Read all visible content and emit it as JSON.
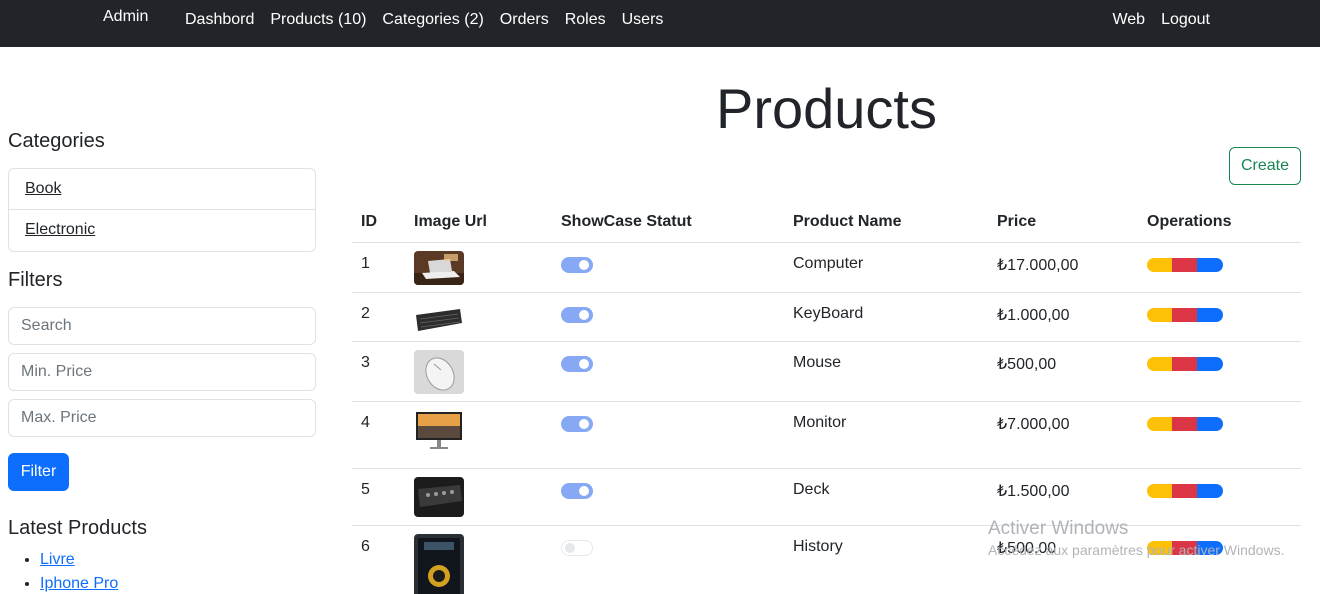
{
  "navbar": {
    "brand": "Admin",
    "links": [
      "Dashbord",
      "Products (10)",
      "Categories (2)",
      "Orders",
      "Roles",
      "Users"
    ],
    "right_links": [
      "Web",
      "Logout"
    ]
  },
  "sidebar": {
    "categories_title": "Categories",
    "categories": [
      "Book",
      "Electronic"
    ],
    "filters_title": "Filters",
    "search_placeholder": "Search",
    "min_price_placeholder": "Min. Price",
    "max_price_placeholder": "Max. Price",
    "filter_button": "Filter",
    "latest_title": "Latest Products",
    "latest": [
      "Livre",
      "Iphone Pro"
    ]
  },
  "main": {
    "title": "Products",
    "create_button": "Create",
    "columns": [
      "ID",
      "Image Url",
      "ShowCase Statut",
      "Product Name",
      "Price",
      "Operations"
    ],
    "rows": [
      {
        "id": "1",
        "name": "Computer",
        "price": "₺17.000,00",
        "showcase": true
      },
      {
        "id": "2",
        "name": "KeyBoard",
        "price": "₺1.000,00",
        "showcase": true
      },
      {
        "id": "3",
        "name": "Mouse",
        "price": "₺500,00",
        "showcase": true
      },
      {
        "id": "4",
        "name": "Monitor",
        "price": "₺7.000,00",
        "showcase": true
      },
      {
        "id": "5",
        "name": "Deck",
        "price": "₺1.500,00",
        "showcase": true
      },
      {
        "id": "6",
        "name": "History",
        "price": "₺500,00",
        "showcase": false
      }
    ]
  },
  "watermark": {
    "line1": "Activer Windows",
    "line2": "Accédez aux paramètres pour activer Windows."
  },
  "colors": {
    "navbar": "#212529",
    "primary": "#0d6efd",
    "success": "#198754",
    "warning": "#ffc107",
    "danger": "#dc3545"
  }
}
